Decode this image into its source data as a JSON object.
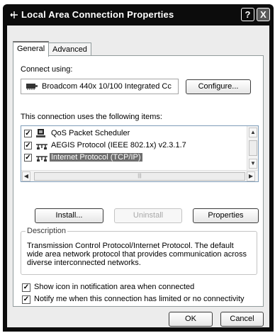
{
  "window": {
    "title": "Local Area Connection Properties",
    "help_label": "?",
    "close_label": "X",
    "title_icon": "network-connection-icon"
  },
  "tabs": [
    {
      "label": "General",
      "active": true
    },
    {
      "label": "Advanced",
      "active": false
    }
  ],
  "general": {
    "connect_using_label": "Connect using:",
    "adapter_name": "Broadcom 440x 10/100 Integrated Cc",
    "adapter_icon": "network-card-icon",
    "configure_label": "Configure...",
    "items_label": "This connection uses the following items:",
    "items": [
      {
        "label": "QoS Packet Scheduler",
        "checked": true,
        "selected": false,
        "icon": "qos-scheduler-icon"
      },
      {
        "label": "AEGIS Protocol (IEEE 802.1x) v2.3.1.7",
        "checked": true,
        "selected": false,
        "icon": "protocol-icon"
      },
      {
        "label": "Internet Protocol (TCP/IP)",
        "checked": true,
        "selected": true,
        "icon": "protocol-icon"
      }
    ],
    "install_label": "Install...",
    "uninstall_label": "Uninstall",
    "properties_label": "Properties",
    "description_legend": "Description",
    "description_text": "Transmission Control Protocol/Internet Protocol. The default wide area network protocol that provides communication across diverse interconnected networks.",
    "show_icon_label": "Show icon in notification area when connected",
    "show_icon_checked": true,
    "notify_label": "Notify me when this connection has limited or no connectivity",
    "notify_checked": true
  },
  "buttons": {
    "ok_label": "OK",
    "cancel_label": "Cancel"
  },
  "colors": {
    "titlebar": "#0c0c0c",
    "selection": "#6e6e6e",
    "dialog_bg": "#ececec"
  }
}
